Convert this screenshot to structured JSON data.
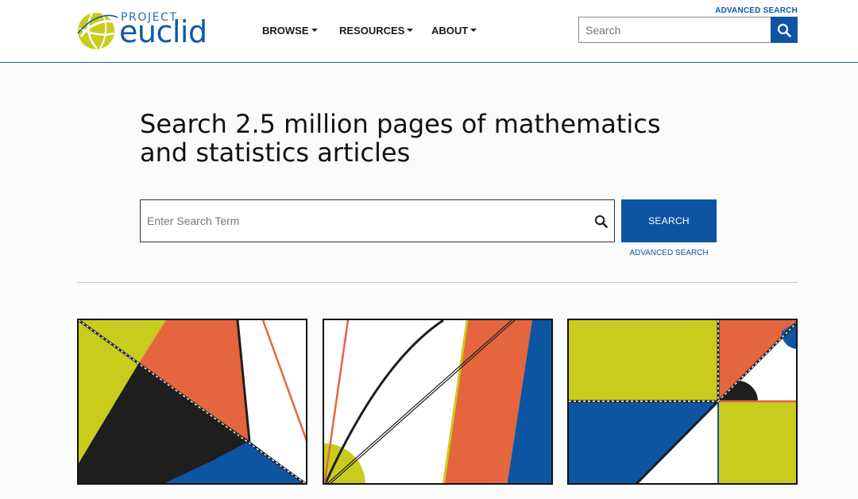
{
  "header": {
    "logo": {
      "small_text": "PROJECT",
      "big_text": "euclid",
      "icon": "globe-logo-icon",
      "colors": {
        "globe": "#c9cc1d",
        "text": "#0e5aa7"
      }
    },
    "nav": [
      {
        "label": "BROWSE",
        "icon": "caret-down-icon"
      },
      {
        "label": "RESOURCES",
        "icon": "caret-down-icon"
      },
      {
        "label": "ABOUT",
        "icon": "caret-down-icon"
      }
    ],
    "advanced_search_label": "ADVANCED SEARCH",
    "search": {
      "placeholder": "Search",
      "value": "",
      "icon": "search-icon"
    }
  },
  "hero": {
    "title": "Search 2.5 million pages of mathematics and statistics articles",
    "search": {
      "placeholder": "Enter Search Term",
      "value": "",
      "icon": "search-icon"
    },
    "search_button_label": "SEARCH",
    "advanced_search_label": "ADVANCED SEARCH"
  },
  "tiles": [
    {
      "name": "geometric-art-tile-1"
    },
    {
      "name": "geometric-art-tile-2"
    },
    {
      "name": "geometric-art-tile-3"
    }
  ],
  "colors": {
    "brand_blue": "#0d55a3",
    "lime": "#c9cc1d",
    "orange": "#e4653e",
    "black": "#1e1e1e",
    "header_rule": "#2f5f93"
  }
}
